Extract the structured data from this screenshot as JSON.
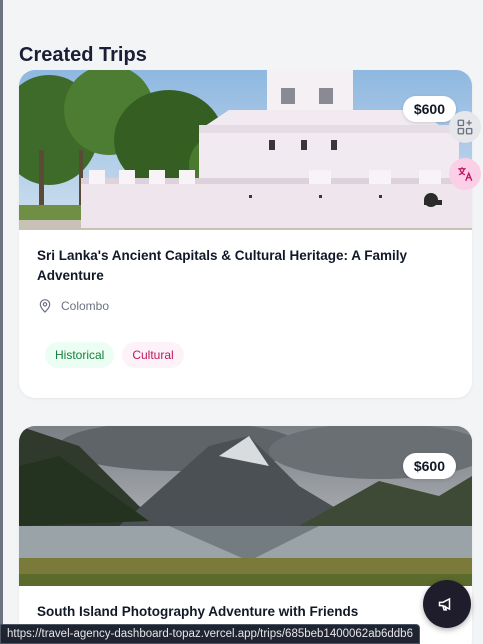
{
  "page": {
    "title": "Created Trips"
  },
  "trips": [
    {
      "price": "$600",
      "title": "Sri Lanka's Ancient Capitals & Cultural Heritage: A Family Adventure",
      "location": "Colombo",
      "tags": [
        "Historical",
        "Cultural"
      ]
    },
    {
      "price": "$600",
      "title": "South Island Photography Adventure with Friends"
    }
  ],
  "status_bar": {
    "url": "https://travel-agency-dashboard-topaz.vercel.app/trips/685beb1400062ab6ddb6"
  },
  "icons": {
    "location": "map-pin-icon",
    "apps": "sparkle-apps-icon",
    "translate": "translate-icon",
    "chat": "megaphone-icon"
  },
  "colors": {
    "historical_bg": "#ecfdf3",
    "historical_text": "#15803d",
    "cultural_bg": "#fdf2f8",
    "cultural_text": "#be185d"
  }
}
